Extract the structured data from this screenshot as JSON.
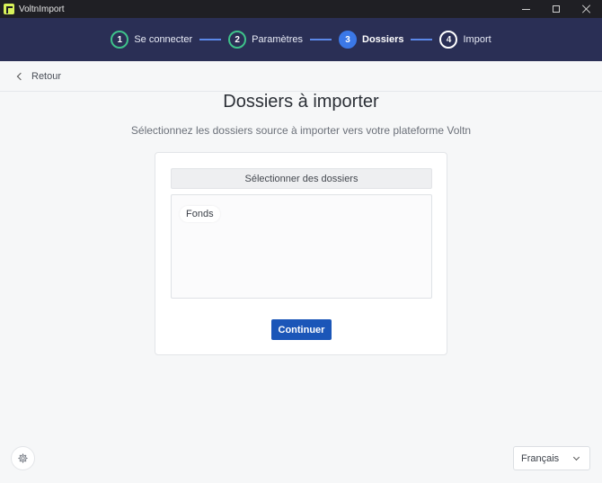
{
  "window": {
    "title": "VoltnImport"
  },
  "stepper": {
    "steps": [
      {
        "number": "1",
        "label": "Se connecter",
        "state": "done"
      },
      {
        "number": "2",
        "label": "Paramètres",
        "state": "done"
      },
      {
        "number": "3",
        "label": "Dossiers",
        "state": "active"
      },
      {
        "number": "4",
        "label": "Import",
        "state": "pending"
      }
    ]
  },
  "nav": {
    "back_label": "Retour"
  },
  "main": {
    "title": "Dossiers à importer",
    "subtitle": "Sélectionnez les dossiers source à importer vers votre plateforme Voltn",
    "select_button_label": "Sélectionner des dossiers",
    "selected_folders": [
      "Fonds"
    ],
    "continue_label": "Continuer"
  },
  "footer": {
    "settings_icon": "gear-icon",
    "language": "Français"
  },
  "colors": {
    "stepper_bg": "#2a2f55",
    "step_done": "#3ec28a",
    "step_active": "#3b78e7",
    "primary_button": "#1b56b8"
  }
}
